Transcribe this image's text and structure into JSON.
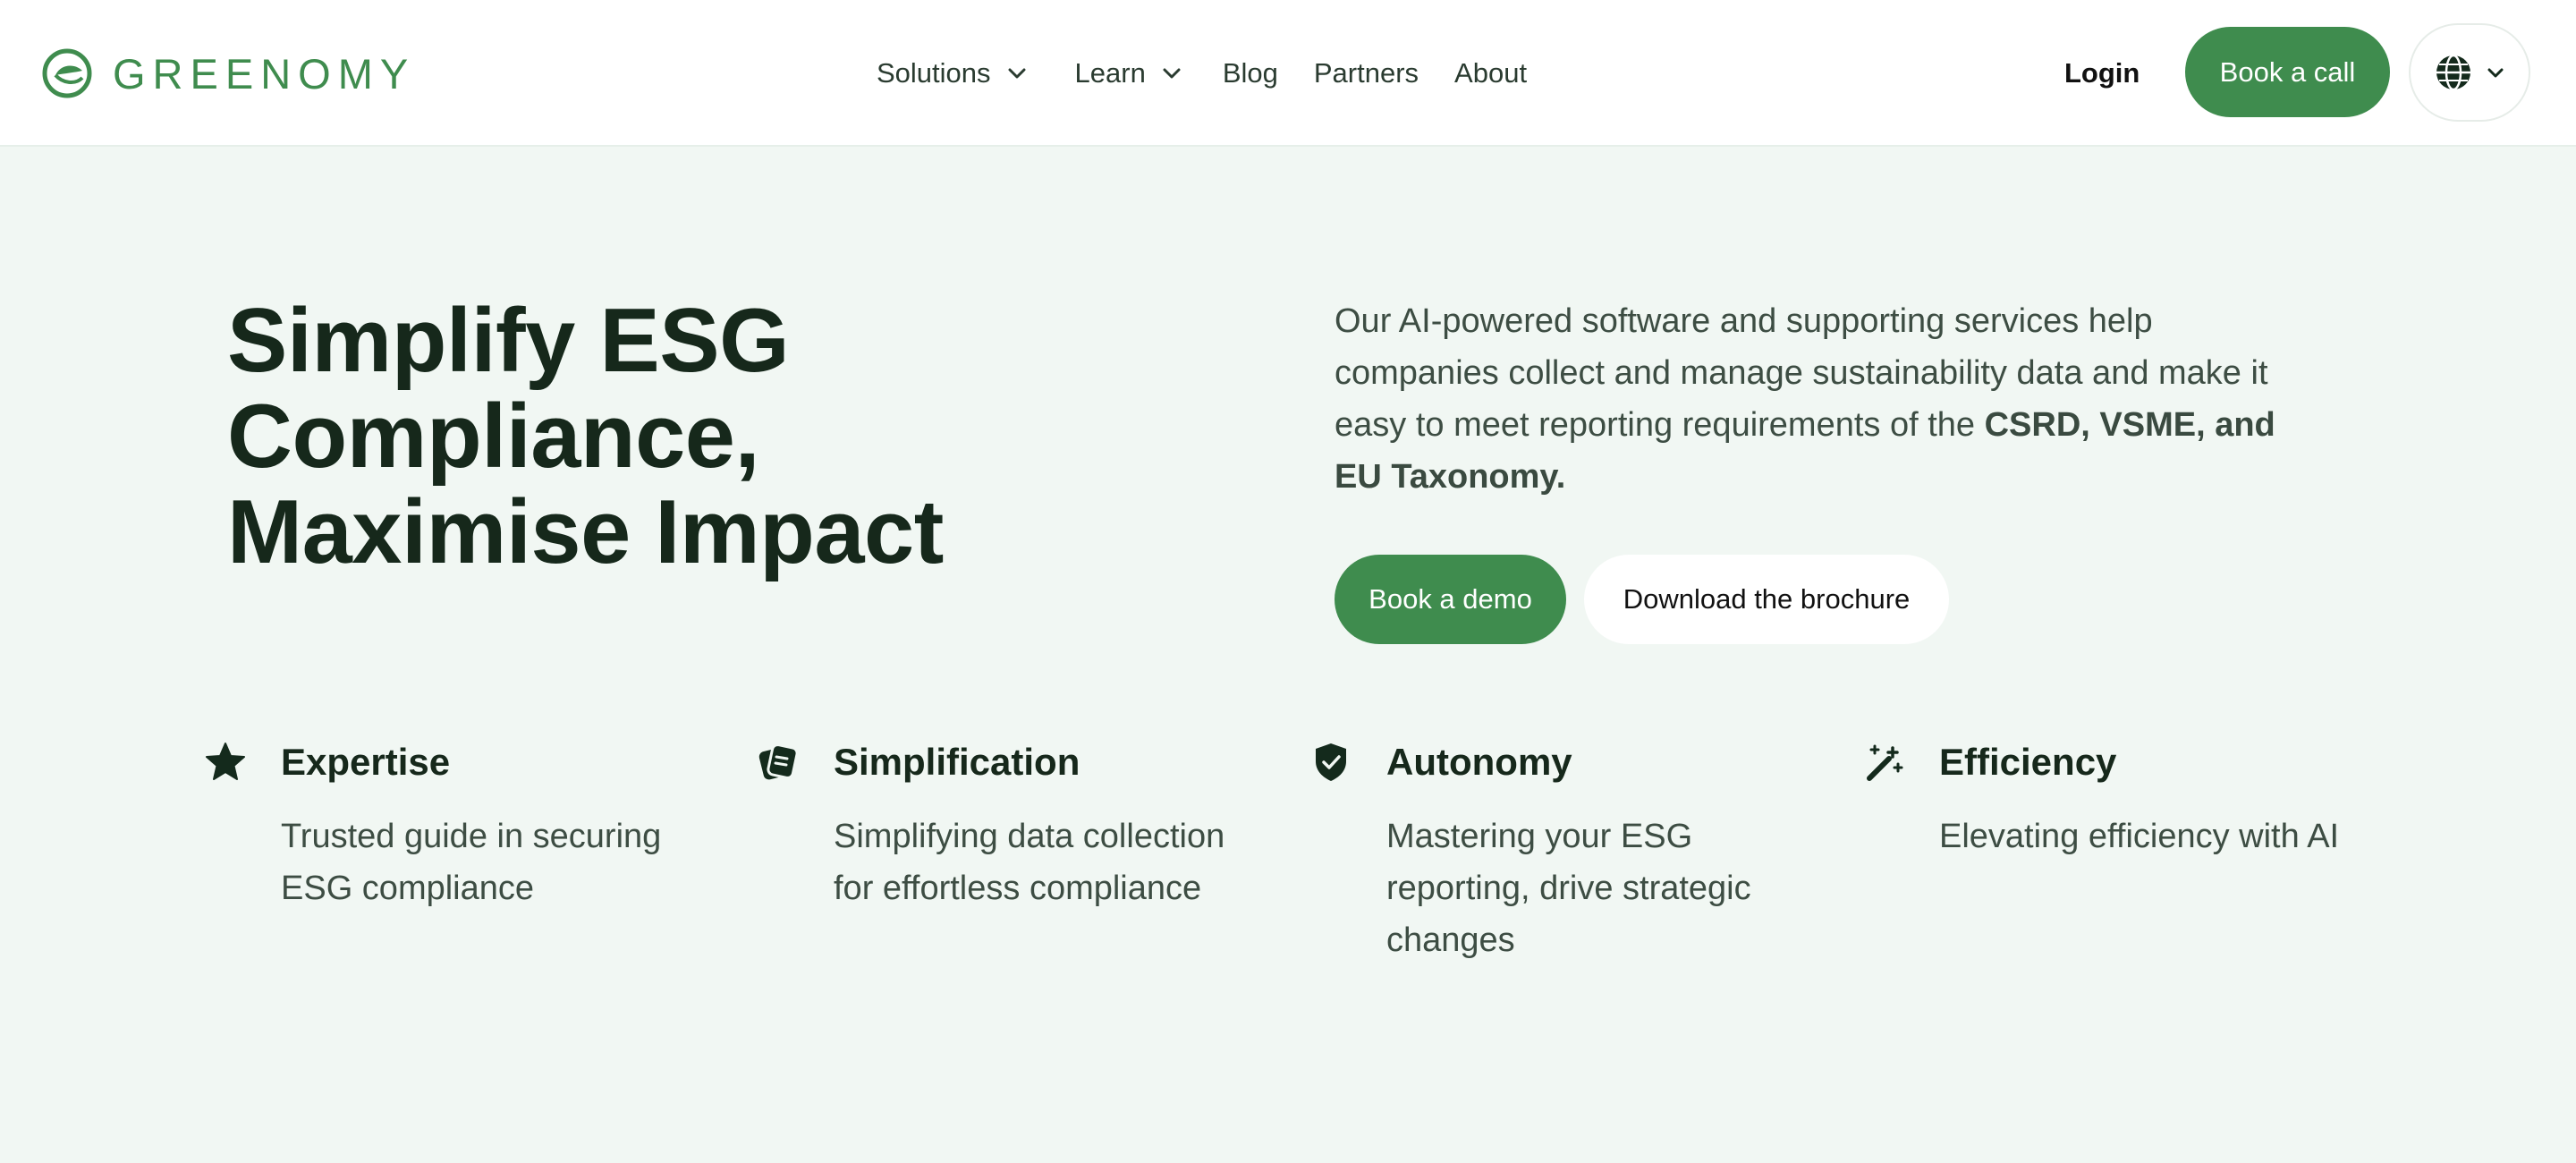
{
  "brand": {
    "name": "GREENOMY",
    "color": "#3f8c4e",
    "logo_icon": "leaf-c-logo-icon"
  },
  "nav": {
    "items": [
      {
        "label": "Solutions",
        "has_dropdown": true
      },
      {
        "label": "Learn",
        "has_dropdown": true
      },
      {
        "label": "Blog",
        "has_dropdown": false
      },
      {
        "label": "Partners",
        "has_dropdown": false
      },
      {
        "label": "About",
        "has_dropdown": false
      }
    ]
  },
  "header_actions": {
    "login_label": "Login",
    "book_call_label": "Book a call",
    "language_icon": "globe-icon"
  },
  "hero": {
    "title_lines": [
      "Simplify ESG",
      "Compliance,",
      "Maximise Impact"
    ],
    "description_plain": "Our AI-powered software and supporting services help companies collect and manage sustainability data and make it easy to meet reporting requirements of the ",
    "description_bold": "CSRD, VSME, and EU Taxonomy.",
    "primary_cta": "Book a demo",
    "secondary_cta": "Download the brochure"
  },
  "features": [
    {
      "icon": "star-icon",
      "title": "Expertise",
      "description": "Trusted guide in securing ESG compliance"
    },
    {
      "icon": "cards-icon",
      "title": "Simplification",
      "description": "Simplifying data collection for effortless compliance"
    },
    {
      "icon": "shield-check-icon",
      "title": "Autonomy",
      "description": "Mastering your ESG reporting, drive strategic changes"
    },
    {
      "icon": "magic-wand-icon",
      "title": "Efficiency",
      "description": "Elevating efficiency with AI"
    }
  ],
  "colors": {
    "accent": "#3f8c4e",
    "background": "#f1f7f3",
    "heading": "#16281b",
    "body_text": "#3d4d43"
  }
}
